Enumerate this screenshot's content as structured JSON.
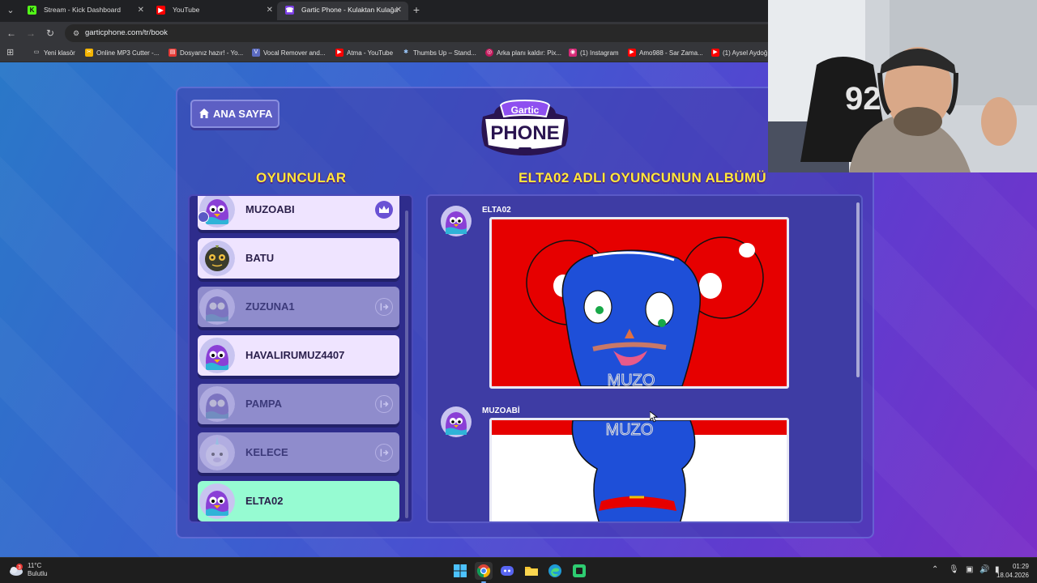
{
  "browser": {
    "tabs": [
      {
        "title": "Stream - Kick Dashboard",
        "icon": "kick-icon",
        "color": "#53fc18",
        "active": false
      },
      {
        "title": "YouTube",
        "icon": "youtube-icon",
        "color": "#ff0000",
        "active": false
      },
      {
        "title": "Gartic Phone - Kulaktan Kulağa",
        "icon": "gartic-icon",
        "color": "#7b3fe4",
        "active": true
      }
    ],
    "url": "garticphone.com/tr/book",
    "bookmarks": [
      {
        "label": "Yeni klasör",
        "icon": "folder-icon"
      },
      {
        "label": "Online MP3 Cutter -...",
        "icon": "scissors-icon"
      },
      {
        "label": "Dosyanız hazır! - Yo...",
        "icon": "document-icon"
      },
      {
        "label": "Vocal Remover and...",
        "icon": "vocal-remover-icon"
      },
      {
        "label": "Atma - YouTube",
        "icon": "youtube-icon"
      },
      {
        "label": "Thumbs Up – Stand...",
        "icon": "star-icon"
      },
      {
        "label": "Arka planı kaldır: Pix...",
        "icon": "remove-bg-icon"
      },
      {
        "label": "(1) Instagram",
        "icon": "instagram-icon"
      },
      {
        "label": "Amo988 - Sar Zama...",
        "icon": "youtube-icon"
      },
      {
        "label": "(1) Aysel Aydoğ...",
        "icon": "youtube-icon"
      }
    ]
  },
  "game": {
    "home_button": "ANA SAYFA",
    "logo_top": "Gartic",
    "logo_bottom": "PHONE",
    "players_title": "OYUNCULAR",
    "album_title": "ELTA02 ADLI OYUNCUNUN ALBÜMÜ",
    "players": [
      {
        "name": "MUZOABI",
        "state": "white",
        "badge": "crown-icon",
        "owner": true
      },
      {
        "name": "BATU",
        "state": "white",
        "badge": "",
        "owner": false
      },
      {
        "name": "ZUZUNA1",
        "state": "gray",
        "badge": "leave-icon",
        "owner": false
      },
      {
        "name": "HAVALIRUMUZ4407",
        "state": "white",
        "badge": "",
        "owner": false
      },
      {
        "name": "PAMPA",
        "state": "gray",
        "badge": "leave-icon",
        "owner": false
      },
      {
        "name": "KELECE",
        "state": "gray",
        "badge": "leave-icon",
        "owner": false
      },
      {
        "name": "ELTA02",
        "state": "active",
        "badge": "",
        "owner": false
      }
    ],
    "album": [
      {
        "author": "ELTA02",
        "drawing_text": "MUZO"
      },
      {
        "author": "MUZOABİ",
        "drawing_text": "MUZO"
      }
    ]
  },
  "taskbar": {
    "weather_temp": "11°C",
    "weather_desc": "Bulutlu",
    "weather_alert": "3",
    "time": "01:29",
    "date": "18.04.2026"
  }
}
